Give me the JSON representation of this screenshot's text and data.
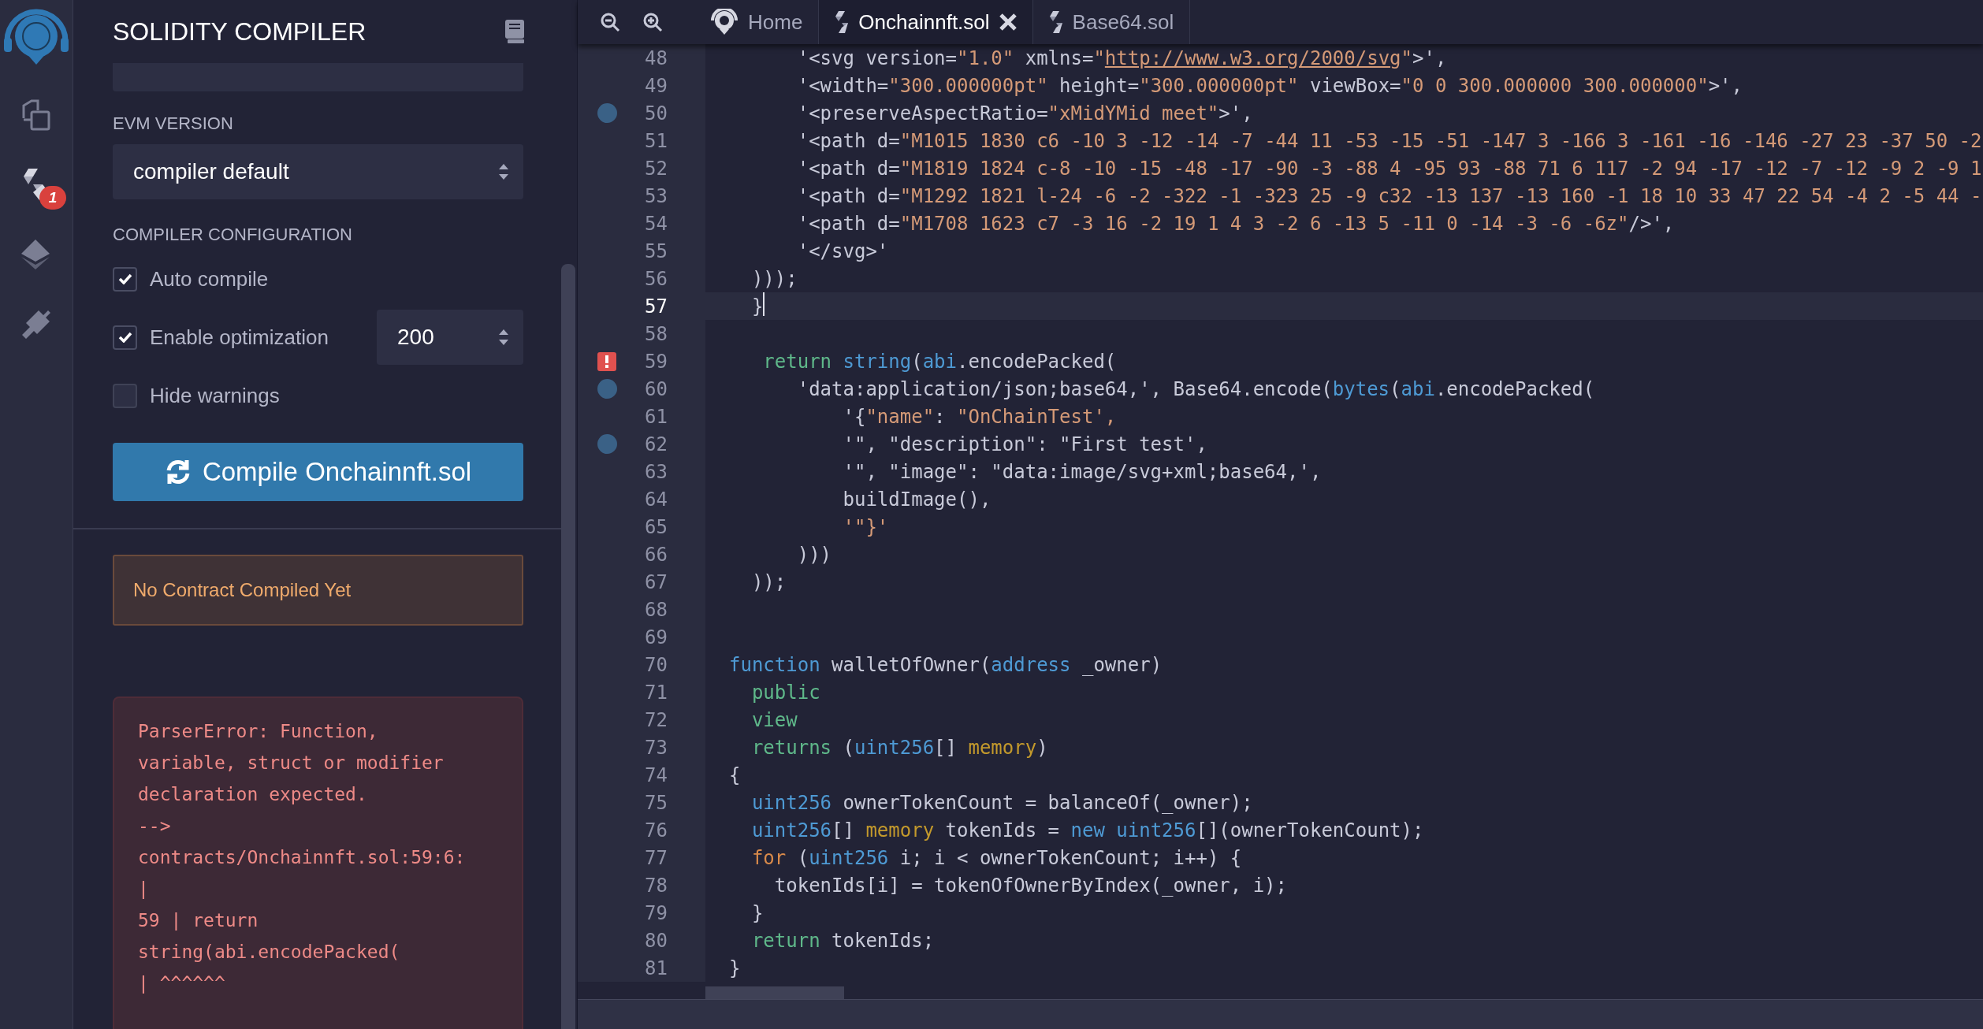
{
  "activity_bar": {
    "items": [
      {
        "kind": "files"
      },
      {
        "kind": "compiler",
        "badge": "1"
      },
      {
        "kind": "deploy"
      },
      {
        "kind": "plugins"
      }
    ]
  },
  "side_panel": {
    "title": "SOLIDITY COMPILER",
    "evm_version": {
      "label": "EVM VERSION",
      "value": "compiler default"
    },
    "configuration": {
      "label": "COMPILER CONFIGURATION",
      "options": [
        {
          "label": "Auto compile",
          "checked": true
        },
        {
          "label": "Enable optimization",
          "checked": true,
          "runs": "200"
        },
        {
          "label": "Hide warnings",
          "checked": false
        }
      ]
    },
    "compile_button": "Compile Onchainnft.sol",
    "notice": "No Contract Compiled Yet",
    "error": "ParserError: Function,\nvariable, struct or modifier\ndeclaration expected.\n-->\ncontracts/Onchainnft.sol:59:6:\n|\n59 | return\nstring(abi.encodePacked(\n| ^^^^^^"
  },
  "tabs": [
    {
      "label": "Home",
      "kind": "home",
      "selected": false,
      "closable": false
    },
    {
      "label": "Onchainnft.sol",
      "kind": "file",
      "selected": true,
      "closable": true
    },
    {
      "label": "Base64.sol",
      "kind": "file",
      "selected": false,
      "closable": false
    }
  ],
  "editor": {
    "lines": [
      {
        "number": "48",
        "current": false,
        "tokens": [
          {
            "kind": "plain",
            "text": "      '<svg version="
          },
          {
            "kind": "str",
            "text": "\"1.0\""
          },
          {
            "kind": "plain",
            "text": " xmlns="
          },
          {
            "kind": "str",
            "text": "\""
          },
          {
            "kind": "link",
            "text": "http://www.w3.org/2000/svg"
          },
          {
            "kind": "str",
            "text": "\""
          },
          {
            "kind": "plain",
            "text": ">',"
          }
        ]
      },
      {
        "number": "49",
        "current": false,
        "tokens": [
          {
            "kind": "plain",
            "text": "      '<width="
          },
          {
            "kind": "str",
            "text": "\"300.000000pt\""
          },
          {
            "kind": "plain",
            "text": " height="
          },
          {
            "kind": "str",
            "text": "\"300.000000pt\""
          },
          {
            "kind": "plain",
            "text": " viewBox="
          },
          {
            "kind": "str",
            "text": "\"0 0 300.000000 300.000000\""
          },
          {
            "kind": "plain",
            "text": ">',"
          }
        ]
      },
      {
        "number": "50",
        "current": false,
        "marker": {
          "kind": "dot"
        },
        "tokens": [
          {
            "kind": "plain",
            "text": "      '<preserveAspectRatio="
          },
          {
            "kind": "str",
            "text": "\"xMidYMid meet\""
          },
          {
            "kind": "plain",
            "text": ">',"
          }
        ]
      },
      {
        "number": "51",
        "current": false,
        "tokens": [
          {
            "kind": "plain",
            "text": "      '<path d="
          },
          {
            "kind": "str",
            "text": "\"M1015 1830 c6 -10 3 -12 -14 -7 -44 11 -53 -15 -51 -147 3 -166 3 -161 -16 -146 -27 23 -37 50 -2"
          }
        ]
      },
      {
        "number": "52",
        "current": false,
        "tokens": [
          {
            "kind": "plain",
            "text": "      '<path d="
          },
          {
            "kind": "str",
            "text": "\"M1819 1824 c-8 -10 -15 -48 -17 -90 -3 -88 4 -95 93 -88 71 6 117 -2 94 -17 -12 -7 -12 -9 2 -9 1"
          }
        ]
      },
      {
        "number": "53",
        "current": false,
        "tokens": [
          {
            "kind": "plain",
            "text": "      '<path d="
          },
          {
            "kind": "str",
            "text": "\"M1292 1821 l-24 -6 -2 -322 -1 -323 25 -9 c32 -13 137 -13 160 -1 18 10 33 47 22 54 -4 2 -5 44 -"
          }
        ]
      },
      {
        "number": "54",
        "current": false,
        "tokens": [
          {
            "kind": "plain",
            "text": "      '<path d="
          },
          {
            "kind": "str",
            "text": "\"M1708 1623 c7 -3 16 -2 19 1 4 3 -2 6 -13 5 -11 0 -14 -3 -6 -6z\""
          },
          {
            "kind": "plain",
            "text": "/>',"
          }
        ]
      },
      {
        "number": "55",
        "current": false,
        "tokens": [
          {
            "kind": "plain",
            "text": "      '</svg>'"
          }
        ]
      },
      {
        "number": "56",
        "current": false,
        "tokens": [
          {
            "kind": "plain",
            "text": "  )));"
          }
        ]
      },
      {
        "number": "57",
        "current": true,
        "tokens": [
          {
            "kind": "plain",
            "text": "  }"
          }
        ]
      },
      {
        "number": "58",
        "current": false
      },
      {
        "number": "59",
        "current": false,
        "marker": {
          "kind": "error"
        },
        "tokens": [
          {
            "kind": "kw",
            "text": "   return "
          },
          {
            "kind": "type",
            "text": "string"
          },
          {
            "kind": "plain",
            "text": "("
          },
          {
            "kind": "type",
            "text": "abi"
          },
          {
            "kind": "plain",
            "text": ".encodePacked("
          }
        ]
      },
      {
        "number": "60",
        "current": false,
        "marker": {
          "kind": "dot"
        },
        "tokens": [
          {
            "kind": "plain",
            "text": "      'data:application/json;base64,', Base64.encode("
          },
          {
            "kind": "type",
            "text": "bytes"
          },
          {
            "kind": "plain",
            "text": "("
          },
          {
            "kind": "type",
            "text": "abi"
          },
          {
            "kind": "plain",
            "text": ".encodePacked("
          }
        ]
      },
      {
        "number": "61",
        "current": false,
        "tokens": [
          {
            "kind": "plain",
            "text": "          '{"
          },
          {
            "kind": "str",
            "text": "\"name\""
          },
          {
            "kind": "plain",
            "text": ": "
          },
          {
            "kind": "str",
            "text": "\"OnChainTest',"
          }
        ]
      },
      {
        "number": "62",
        "current": false,
        "marker": {
          "kind": "dot"
        },
        "tokens": [
          {
            "kind": "plain",
            "text": "          '\", \"description\": \"First test',"
          }
        ]
      },
      {
        "number": "63",
        "current": false,
        "tokens": [
          {
            "kind": "plain",
            "text": "          '\", \"image\": \"data:image/svg+xml;base64,',"
          }
        ]
      },
      {
        "number": "64",
        "current": false,
        "tokens": [
          {
            "kind": "plain",
            "text": "          buildImage(),"
          }
        ]
      },
      {
        "number": "65",
        "current": false,
        "tokens": [
          {
            "kind": "str",
            "text": "          '\"}'"
          }
        ]
      },
      {
        "number": "66",
        "current": false,
        "tokens": [
          {
            "kind": "plain",
            "text": "      )))"
          }
        ]
      },
      {
        "number": "67",
        "current": false,
        "tokens": [
          {
            "kind": "plain",
            "text": "  ));"
          }
        ]
      },
      {
        "number": "68",
        "current": false
      },
      {
        "number": "69",
        "current": false
      },
      {
        "number": "70",
        "current": false,
        "tokens": [
          {
            "kind": "type",
            "text": "function"
          },
          {
            "kind": "plain",
            "text": " walletOfOwner("
          },
          {
            "kind": "type",
            "text": "address"
          },
          {
            "kind": "plain",
            "text": " _owner)"
          }
        ]
      },
      {
        "number": "71",
        "current": false,
        "tokens": [
          {
            "kind": "kw",
            "text": "  public"
          }
        ]
      },
      {
        "number": "72",
        "current": false,
        "tokens": [
          {
            "kind": "kw",
            "text": "  view"
          }
        ]
      },
      {
        "number": "73",
        "current": false,
        "tokens": [
          {
            "kind": "kw",
            "text": "  returns"
          },
          {
            "kind": "plain",
            "text": " ("
          },
          {
            "kind": "type",
            "text": "uint256"
          },
          {
            "kind": "plain",
            "text": "[] "
          },
          {
            "kind": "mem",
            "text": "memory"
          },
          {
            "kind": "plain",
            "text": ")"
          }
        ]
      },
      {
        "number": "74",
        "current": false,
        "tokens": [
          {
            "kind": "plain",
            "text": "{"
          }
        ]
      },
      {
        "number": "75",
        "current": false,
        "tokens": [
          {
            "kind": "type",
            "text": "  uint256"
          },
          {
            "kind": "plain",
            "text": " ownerTokenCount = balanceOf(_owner);"
          }
        ]
      },
      {
        "number": "76",
        "current": false,
        "tokens": [
          {
            "kind": "type",
            "text": "  uint256"
          },
          {
            "kind": "plain",
            "text": "[] "
          },
          {
            "kind": "mem",
            "text": "memory"
          },
          {
            "kind": "plain",
            "text": " tokenIds = "
          },
          {
            "kind": "type",
            "text": "new uint256"
          },
          {
            "kind": "plain",
            "text": "[](ownerTokenCount);"
          }
        ]
      },
      {
        "number": "77",
        "current": false,
        "tokens": [
          {
            "kind": "ctrl",
            "text": "  for"
          },
          {
            "kind": "plain",
            "text": " ("
          },
          {
            "kind": "type",
            "text": "uint256"
          },
          {
            "kind": "plain",
            "text": " i; i < ownerTokenCount; i++) {"
          }
        ]
      },
      {
        "number": "78",
        "current": false,
        "tokens": [
          {
            "kind": "plain",
            "text": "    tokenIds[i] = tokenOfOwnerByIndex(_owner, i);"
          }
        ]
      },
      {
        "number": "79",
        "current": false,
        "tokens": [
          {
            "kind": "plain",
            "text": "  }"
          }
        ]
      },
      {
        "number": "80",
        "current": false,
        "tokens": [
          {
            "kind": "kw",
            "text": "  return"
          },
          {
            "kind": "plain",
            "text": " tokenIds;"
          }
        ]
      },
      {
        "number": "81",
        "current": false,
        "tokens": [
          {
            "kind": "plain",
            "text": "}"
          }
        ]
      }
    ]
  }
}
